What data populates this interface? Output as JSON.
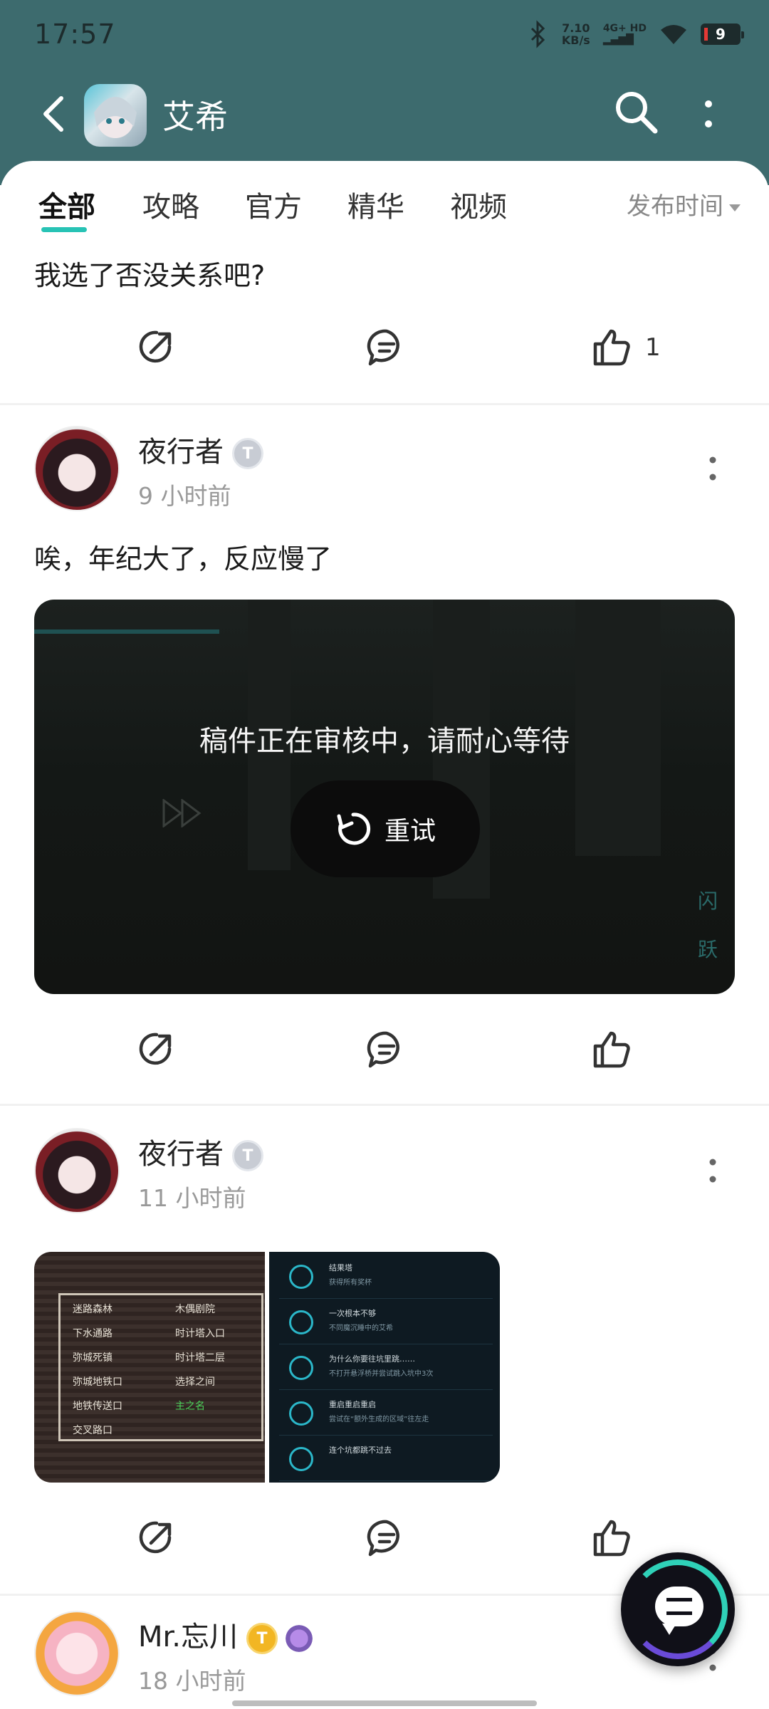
{
  "status_bar": {
    "time": "17:57",
    "net_speed": "7.10",
    "net_unit": "KB/s",
    "net_type": "4G+ HD",
    "battery": "9"
  },
  "header": {
    "title": "艾希"
  },
  "tabs": [
    "全部",
    "攻略",
    "官方",
    "精华",
    "视频"
  ],
  "sort_label": "发布时间",
  "post0": {
    "text": "我选了否没关系吧?",
    "likes": "1"
  },
  "post1": {
    "user": "夜行者",
    "badge": "T",
    "time": "9 小时前",
    "text": "唉，年纪大了，反应慢了",
    "video": {
      "status": "稿件正在审核中，请耐心等待",
      "retry": "重试",
      "side1": "闪",
      "side2": "跃"
    }
  },
  "post2": {
    "user": "夜行者",
    "badge": "T",
    "time": "11 小时前",
    "image1_items": [
      "迷路森林",
      "木偶剧院",
      "下水通路",
      "时计塔入口",
      "弥城死镇",
      "时计塔二层",
      "弥城地铁口",
      "选择之间",
      "地铁传送口",
      "主之名",
      "交叉路口"
    ],
    "image2_rows": [
      {
        "title": "结果塔",
        "desc": "获得所有奖杯"
      },
      {
        "title": "一次根本不够",
        "desc": "不同魔沉睡中的艾希"
      },
      {
        "title": "为什么你要往坑里跳……",
        "desc": "不打开悬浮桥并尝试跳入坑中3次"
      },
      {
        "title": "重启重启重启",
        "desc": "尝试在“额外生成的区域”往左走"
      },
      {
        "title": "连个坑都跳不过去",
        "desc": ""
      }
    ]
  },
  "post3": {
    "user": "Mr.忘川",
    "badge": "T",
    "time": "18 小时前"
  }
}
